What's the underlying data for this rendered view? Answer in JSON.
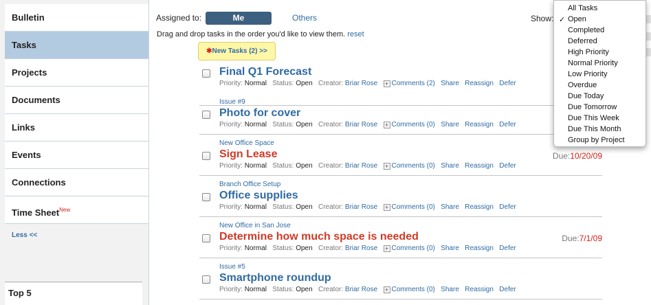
{
  "sidebar": {
    "items": [
      {
        "label": "Bulletin",
        "badge": ""
      },
      {
        "label": "Tasks",
        "badge": ""
      },
      {
        "label": "Projects",
        "badge": ""
      },
      {
        "label": "Documents",
        "badge": ""
      },
      {
        "label": "Links",
        "badge": ""
      },
      {
        "label": "Events",
        "badge": ""
      },
      {
        "label": "Connections",
        "badge": ""
      },
      {
        "label": "Time Sheet",
        "badge": "New"
      }
    ],
    "less_link": "Less <<",
    "top5": "Top 5"
  },
  "header": {
    "assigned_to": "Assigned to:",
    "me": "Me",
    "others": "Others",
    "show": "Show:",
    "hint": "Drag and drop tasks in the order you'd like to view them.",
    "reset": "reset",
    "new_tasks": "New Tasks (2) >>"
  },
  "meta_labels": {
    "priority": "Priority:",
    "status": "Status:",
    "creator": "Creator:",
    "share": "Share",
    "reassign": "Reassign",
    "defer": "Defer",
    "due": "Due:"
  },
  "tasks": [
    {
      "project": "",
      "title": "Final Q1 Forecast",
      "priority": "Normal",
      "status": "Open",
      "creator": "Briar Rose",
      "comments": "Comments (2)",
      "due": ""
    },
    {
      "project": "Issue #9",
      "title": "Photo for cover",
      "priority": "Normal",
      "status": "Open",
      "creator": "Briar Rose",
      "comments": "Comments (0)",
      "due": ""
    },
    {
      "project": "New Office Space",
      "title": "Sign Lease",
      "priority": "Normal",
      "status": "Open",
      "creator": "Briar Rose",
      "comments": "Comments (0)",
      "due": "10/20/09"
    },
    {
      "project": "Branch Office Setup",
      "title": "Office supplies",
      "priority": "Normal",
      "status": "Open",
      "creator": "Briar Rose",
      "comments": "Comments (0)",
      "due": ""
    },
    {
      "project": "New Office in San Jose",
      "title": "Determine how much space is needed",
      "priority": "Normal",
      "status": "Open",
      "creator": "Briar Rose",
      "comments": "Comments (0)",
      "due": "7/1/09"
    },
    {
      "project": "Issue #5",
      "title": "Smartphone roundup",
      "priority": "Normal",
      "status": "Open",
      "creator": "Briar Rose",
      "comments": "Comments (0)",
      "due": ""
    }
  ],
  "show_menu": {
    "selected": "Open",
    "options": [
      "All Tasks",
      "Open",
      "Completed",
      "Deferred",
      "High Priority",
      "Normal Priority",
      "Low Priority",
      "Overdue",
      "Due Today",
      "Due Tomorrow",
      "Due This Week",
      "Due This Month",
      "Group by Project"
    ]
  },
  "colors": {
    "link": "#2f6ba2",
    "overdue": "#d03a26",
    "active_nav": "#b3cbe0",
    "toggle": "#3d5f80"
  }
}
